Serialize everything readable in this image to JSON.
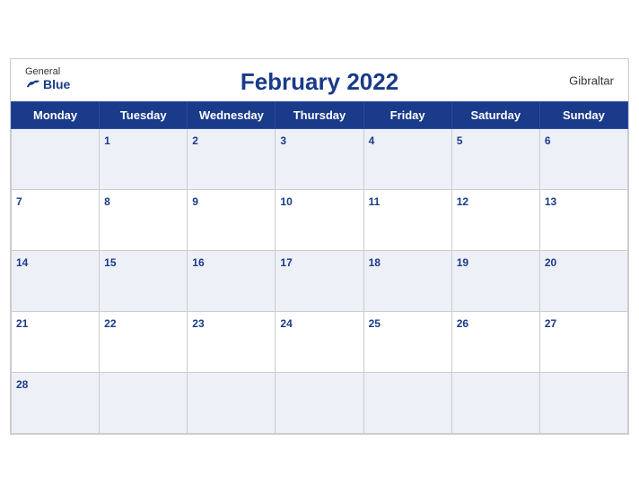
{
  "header": {
    "logo_general": "General",
    "logo_blue": "Blue",
    "title": "February 2022",
    "location": "Gibraltar"
  },
  "weekdays": [
    "Monday",
    "Tuesday",
    "Wednesday",
    "Thursday",
    "Friday",
    "Saturday",
    "Sunday"
  ],
  "weeks": [
    [
      null,
      "1",
      "2",
      "3",
      "4",
      "5",
      "6"
    ],
    [
      "7",
      "8",
      "9",
      "10",
      "11",
      "12",
      "13"
    ],
    [
      "14",
      "15",
      "16",
      "17",
      "18",
      "19",
      "20"
    ],
    [
      "21",
      "22",
      "23",
      "24",
      "25",
      "26",
      "27"
    ],
    [
      "28",
      null,
      null,
      null,
      null,
      null,
      null
    ]
  ]
}
